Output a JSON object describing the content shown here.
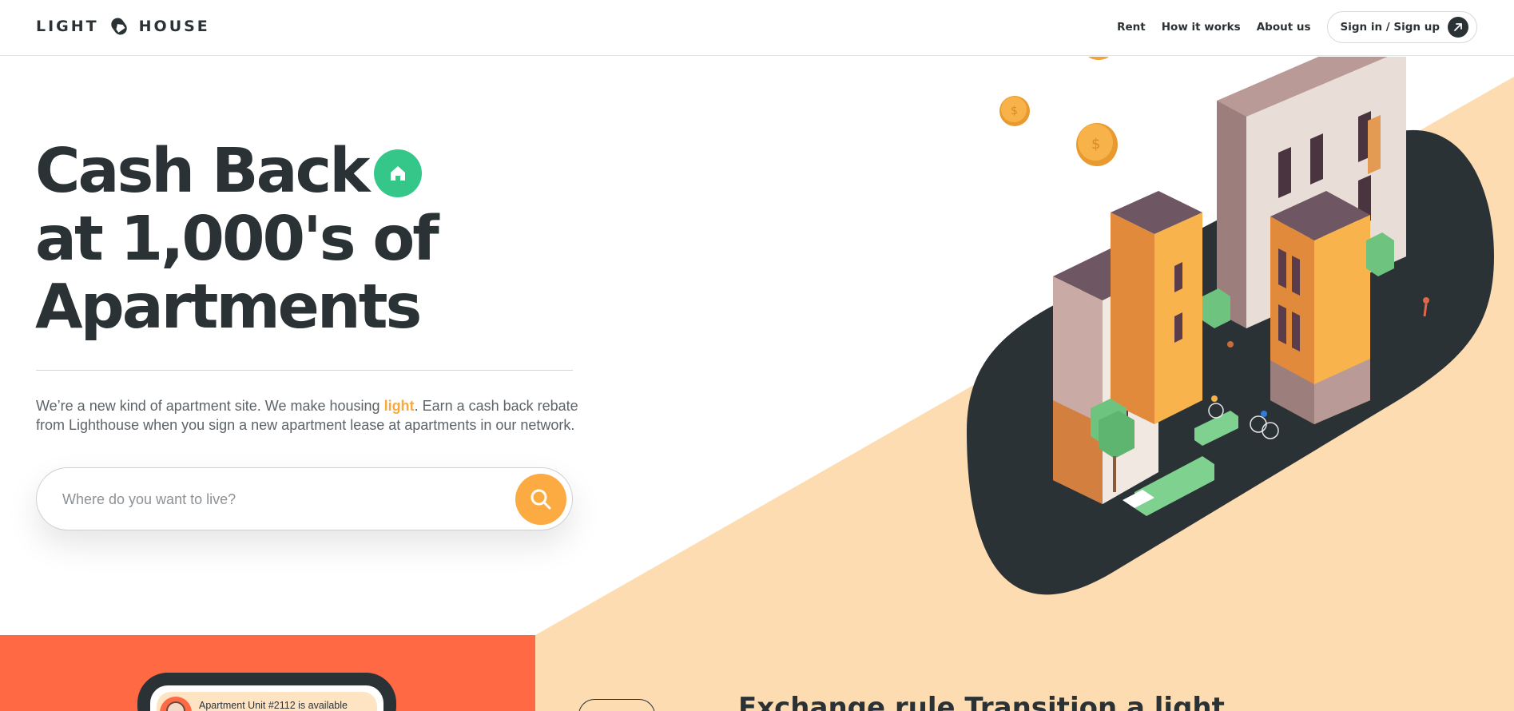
{
  "brand": {
    "word_left": "LIGHT",
    "word_right": "HOUSE",
    "logo_icon": "lighthouse-house-tag-icon"
  },
  "nav": {
    "items": [
      {
        "label": "Rent"
      },
      {
        "label": "How it works"
      },
      {
        "label": "About us"
      }
    ],
    "signin_label": "Sign in / Sign up",
    "signin_icon": "arrow-up-right-icon"
  },
  "hero": {
    "headline": [
      "Cash Back",
      "at 1,000's of",
      "Apartments"
    ],
    "headline_icon": "home-icon",
    "intro_before": "We’re a new kind of apartment site. We make housing ",
    "intro_highlight": "light",
    "intro_after": ". Earn a cash back rebate from Lighthouse when you sign a new apartment lease at apartments in our network.",
    "search_placeholder": "Where do you want to live?",
    "search_icon": "search-icon"
  },
  "band": {
    "notification_text": "Apartment Unit #2112 is available",
    "heading": "Exchange rule Transition a light"
  },
  "colors": {
    "ink": "#2b3236",
    "accent_orange": "#fbab42",
    "accent_green": "#35c78a",
    "peach": "#fddcb2",
    "coral": "#ff6a45",
    "dark_blob": "#2b3236"
  }
}
